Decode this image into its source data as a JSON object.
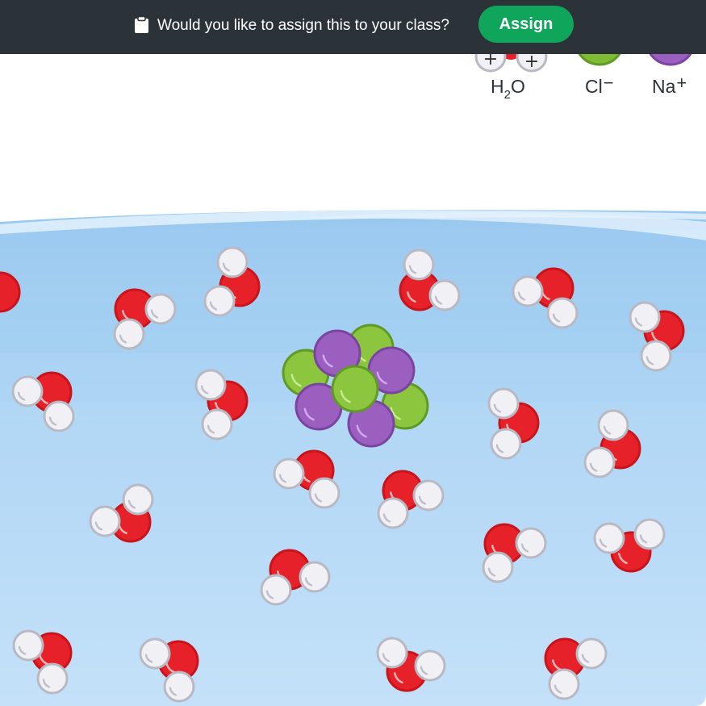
{
  "banner": {
    "icon": "clipboard-icon",
    "prompt": "Would you like to assign this to your class?",
    "assign_label": "Assign",
    "bg_color": "#2b3238",
    "button_color": "#0fa55a"
  },
  "legend": {
    "h2o": {
      "main": "H",
      "sub": "2",
      "tail": "O",
      "icon": "water-molecule-icon"
    },
    "chloride": {
      "label": "Cl",
      "charge": "−",
      "icon": "chloride-ion-icon",
      "color": "#8cc63f"
    },
    "sodium": {
      "label": "Na",
      "charge": "+",
      "icon": "sodium-ion-icon",
      "color": "#9b5fc0"
    }
  },
  "colors": {
    "oxygen": "#e62129",
    "hydrogen": "#f1f1f5",
    "water_light": "#c2e0f8",
    "water_dark": "#9bcaf0"
  }
}
